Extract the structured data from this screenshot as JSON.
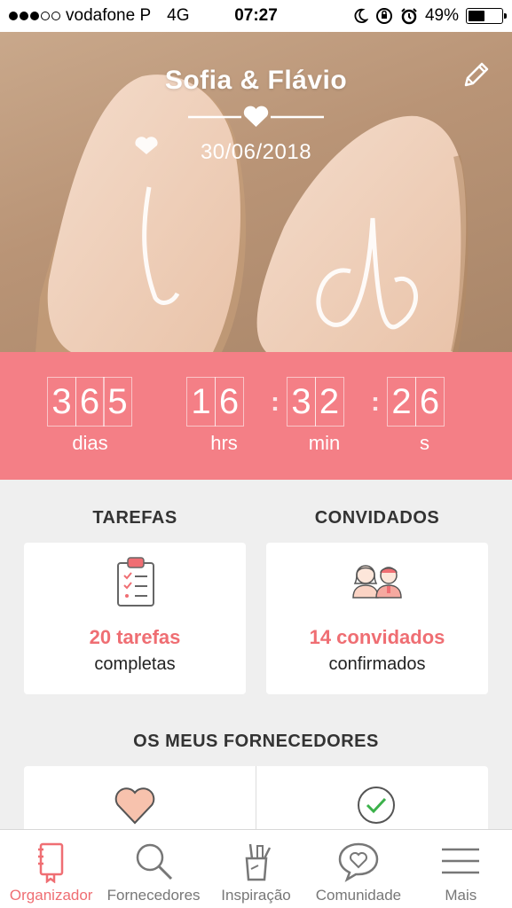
{
  "status_bar": {
    "carrier": "vodafone P",
    "network": "4G",
    "time": "07:27",
    "battery": "49%",
    "battery_level": 0.49
  },
  "hero": {
    "couple": "Sofia & Flávio",
    "date": "30/06/2018"
  },
  "countdown": {
    "days": [
      "3",
      "6",
      "5"
    ],
    "hours": [
      "1",
      "6"
    ],
    "minutes": [
      "3",
      "2"
    ],
    "seconds": [
      "2",
      "6"
    ],
    "labels": {
      "days": "dias",
      "hours": "hrs",
      "minutes": "min",
      "seconds": "s"
    }
  },
  "tasks": {
    "title": "TAREFAS",
    "count": "20 tarefas",
    "status": "completas"
  },
  "guests": {
    "title": "CONVIDADOS",
    "count": "14 convidados",
    "status": "confirmados"
  },
  "vendors": {
    "title": "OS MEUS FORNECEDORES"
  },
  "tabbar": {
    "items": [
      {
        "label": "Organizador",
        "icon": "notebook-icon"
      },
      {
        "label": "Fornecedores",
        "icon": "search-icon"
      },
      {
        "label": "Inspiração",
        "icon": "pencil-cup-icon"
      },
      {
        "label": "Comunidade",
        "icon": "chat-heart-icon"
      },
      {
        "label": "Mais",
        "icon": "menu-icon"
      }
    ]
  },
  "colors": {
    "accent": "#ef6e73",
    "countdown_bg": "#f47f86",
    "background": "#efefef"
  }
}
